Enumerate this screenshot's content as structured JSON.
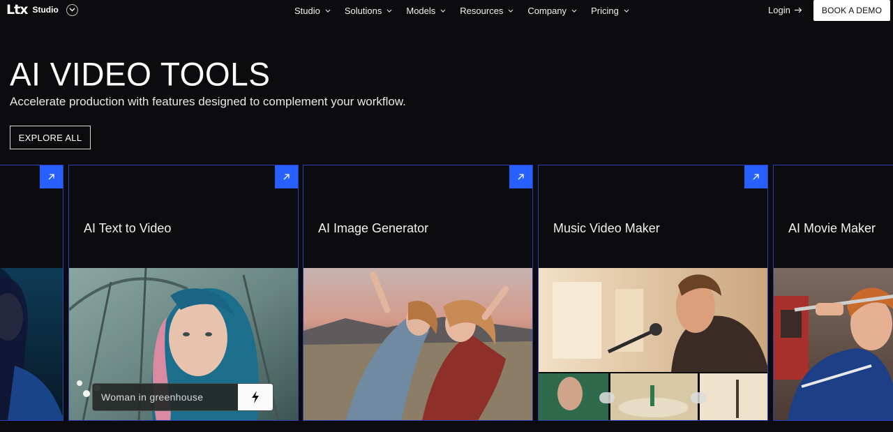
{
  "header": {
    "logo_mark": "Ltx",
    "logo_sub": "Studio",
    "nav": [
      {
        "label": "Studio"
      },
      {
        "label": "Solutions"
      },
      {
        "label": "Models"
      },
      {
        "label": "Resources"
      },
      {
        "label": "Company"
      },
      {
        "label": "Pricing"
      }
    ],
    "login_label": "Login",
    "demo_label": "BOOK A DEMO"
  },
  "hero": {
    "title": "AI VIDEO TOOLS",
    "subtitle": "Accelerate production with features designed to complement your workflow.",
    "explore_label": "EXPLORE ALL"
  },
  "cards": [
    {
      "title": ""
    },
    {
      "title": "AI Text to Video",
      "prompt": "Woman in greenhouse"
    },
    {
      "title": "AI Image Generator"
    },
    {
      "title": "Music Video Maker"
    },
    {
      "title": "AI Movie Maker"
    }
  ],
  "colors": {
    "background": "#0c0c0e",
    "accent": "#2760ff",
    "card_border": "#2c3db8"
  },
  "icons": {
    "card_link": "arrow-up-right-icon",
    "prompt_go": "lightning-icon",
    "login": "arrow-right-icon",
    "nav_caret": "chevron-down-icon"
  }
}
